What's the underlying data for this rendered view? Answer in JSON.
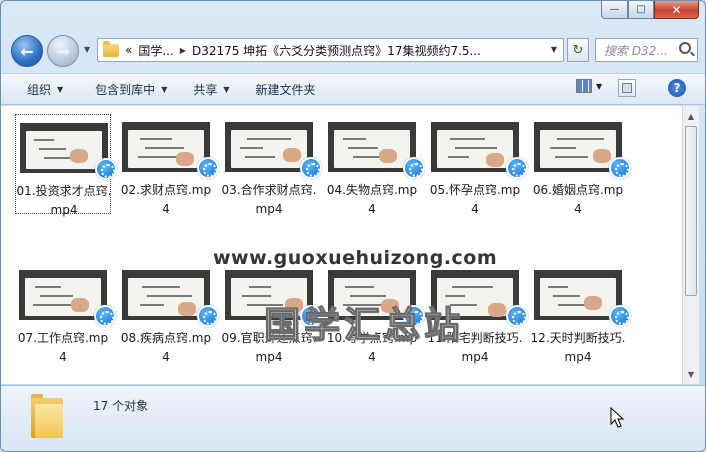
{
  "window": {
    "caption_buttons": {
      "minimize": "—",
      "maximize": "□",
      "close": "✕"
    }
  },
  "nav": {
    "back_icon": "back-arrow-icon",
    "forward_icon": "forward-arrow-icon",
    "breadcrumb": [
      "«",
      "国学...",
      "D32175 坤拓《六爻分类预测点窍》17集视频约7.5..."
    ],
    "search_placeholder": "搜索 D32..."
  },
  "toolbar": {
    "organize": "组织",
    "include_in_library": "包含到库中",
    "share": "共享",
    "new_folder": "新建文件夹"
  },
  "files": [
    {
      "name": "01.投资求才点窍.mp4"
    },
    {
      "name": "02.求财点窍.mp4"
    },
    {
      "name": "03.合作求财点窍.mp4"
    },
    {
      "name": "04.失物点窍.mp4"
    },
    {
      "name": "05.怀孕点窍.mp4"
    },
    {
      "name": "06.婚姻点窍.mp4"
    },
    {
      "name": "07.工作点窍.mp4"
    },
    {
      "name": "08.疾病点窍.mp4"
    },
    {
      "name": "09.官职升迁点窍.mp4"
    },
    {
      "name": "10.考学点窍.mp4"
    },
    {
      "name": "11.阳宅判断技巧.mp4"
    },
    {
      "name": "12.天时判断技巧.mp4"
    }
  ],
  "watermark": {
    "title": "国学汇总站",
    "url": "www.guoxuehuizong.com"
  },
  "details": {
    "count": "17 个对象"
  }
}
